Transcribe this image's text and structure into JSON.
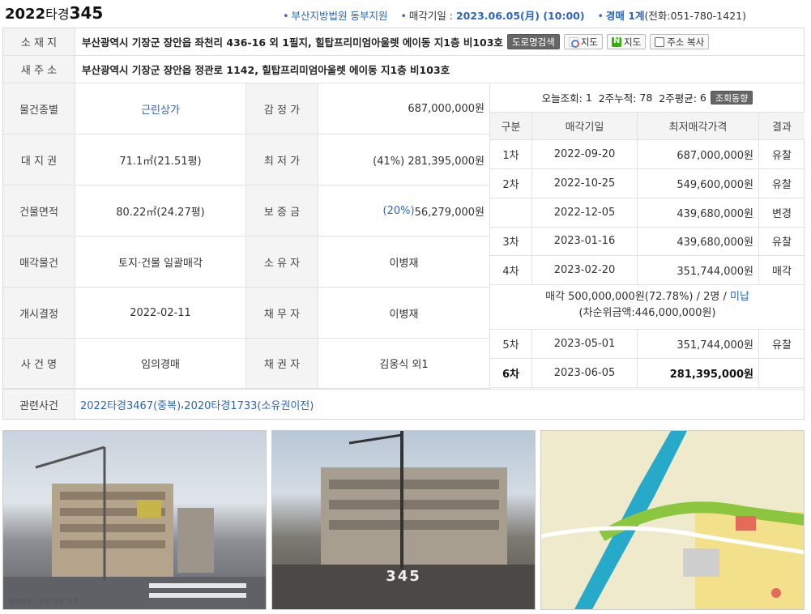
{
  "header": {
    "case_year": "2022",
    "case_kind": "타경",
    "case_num": "345",
    "court": "부산지방법원 동부지원",
    "sale_date_label": "매각기일 :",
    "sale_date_value": "2023.06.05(月) (10:00)",
    "dept_value": "경매 1계",
    "phone": "(전화:051-780-1421)"
  },
  "location": {
    "label": "소 재 지",
    "value": "부산광역시 기장군 장안읍 좌천리 436-16 외 1필지, 힐탑프리미엄아울렛 에이동 지1층 비103호",
    "btn_road": "도로명검색",
    "btn_daum": "지도",
    "btn_naver": "지도",
    "btn_copy": "주소 복사"
  },
  "new_address": {
    "label": "새 주 소",
    "value": "부산광역시 기장군 장안읍 정관로 1142, 힐탑프리미엄아울렛 에이동 지1층 비103호"
  },
  "grid": {
    "type_label": "물건종별",
    "type_value": "근린상가",
    "appraisal_label": "감 정 가",
    "appraisal_value": "687,000,000원",
    "land_label": "대 지 권",
    "land_value": "71.1㎡(21.51평)",
    "min_label": "최 저 가",
    "min_value": "(41%) 281,395,000원",
    "bldg_label": "건물면적",
    "bldg_value": "80.22㎡(24.27평)",
    "deposit_label": "보 증 금",
    "deposit_pct": "(20%)",
    "deposit_value": " 56,279,000원",
    "sale_obj_label": "매각물건",
    "sale_obj_value": "토지·건물 일괄매각",
    "owner_label": "소 유 자",
    "owner_value": "이병재",
    "start_label": "개시결정",
    "start_value": "2022-02-11",
    "debtor_label": "채 무 자",
    "debtor_value": "이병재",
    "case_name_label": "사 건 명",
    "case_name_value": "임의경매",
    "creditor_label": "채 권 자",
    "creditor_value": "김웅식 외1"
  },
  "stats": {
    "today_label": "오늘조회:",
    "today": "1",
    "two_week_label": "2주누적:",
    "two_week": "78",
    "avg_label": "2주평균:",
    "avg": "6",
    "btn": "조회동향"
  },
  "history": {
    "headers": [
      "구분",
      "매각기일",
      "최저매각가격",
      "결과"
    ],
    "rows": [
      {
        "round": "1차",
        "date": "2022-09-20",
        "price": "687,000,000원",
        "result": "유찰"
      },
      {
        "round": "2차",
        "date": "2022-10-25",
        "price": "549,600,000원",
        "result": "유찰"
      },
      {
        "round": "",
        "date": "2022-12-05",
        "price": "439,680,000원",
        "result": "변경"
      },
      {
        "round": "3차",
        "date": "2023-01-16",
        "price": "439,680,000원",
        "result": "유찰"
      },
      {
        "round": "4차",
        "date": "2023-02-20",
        "price": "351,744,000원",
        "result": "매각"
      }
    ],
    "sale_line1": "매각 500,000,000원(72.78%) / 2명 / ",
    "sale_unpaid": "미납",
    "sale_line2": "(차순위금액:446,000,000원)",
    "rows2": [
      {
        "round": "5차",
        "date": "2023-05-01",
        "price": "351,744,000원",
        "result": "유찰"
      },
      {
        "round": "6차",
        "date": "2023-06-05",
        "price": "281,395,000원",
        "result": ""
      }
    ]
  },
  "related": {
    "label": "관련사건",
    "link1": "2022타경3467(중복)",
    "sep": ", ",
    "link2": "2020타경1733(소유권이전)"
  },
  "photos": {
    "caption": "사진설명 : 본건 건물 외관",
    "watermark": "345"
  }
}
